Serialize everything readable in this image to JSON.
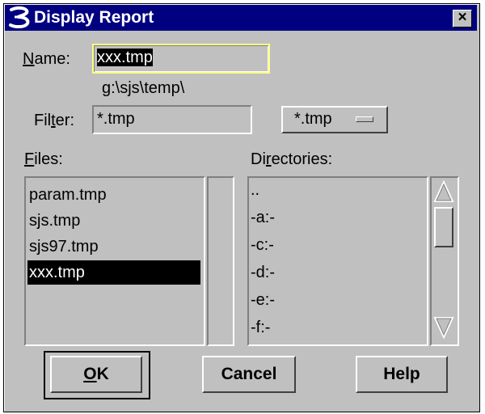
{
  "window": {
    "title": "Display Report",
    "close_glyph": "×",
    "icon": "app-logo-icon"
  },
  "name": {
    "label_underlined": "N",
    "label_rest": "ame:",
    "value": "xxx.tmp"
  },
  "path": "g:\\sjs\\temp\\",
  "filter": {
    "label_pre": "Fil",
    "label_underlined": "t",
    "label_post": "er:",
    "value": "*.tmp",
    "dropdown_value": "*.tmp"
  },
  "files": {
    "label_underlined": "F",
    "label_rest": "iles:",
    "items": [
      "param.tmp",
      "sjs.tmp",
      "sjs97.tmp",
      "xxx.tmp"
    ],
    "selected_index": 3
  },
  "directories": {
    "label_pre": "Di",
    "label_underlined": "r",
    "label_post": "ectories:",
    "items": [
      "..",
      "-a:-",
      "-c:-",
      "-d:-",
      "-e:-",
      "-f:-"
    ]
  },
  "buttons": {
    "ok_underlined": "O",
    "ok_rest": "K",
    "cancel": "Cancel",
    "help": "Help"
  },
  "colors": {
    "titlebar": "#000080",
    "face": "#c0c0c0",
    "selection": "#000000",
    "name_field_highlight": "#ffff80"
  }
}
